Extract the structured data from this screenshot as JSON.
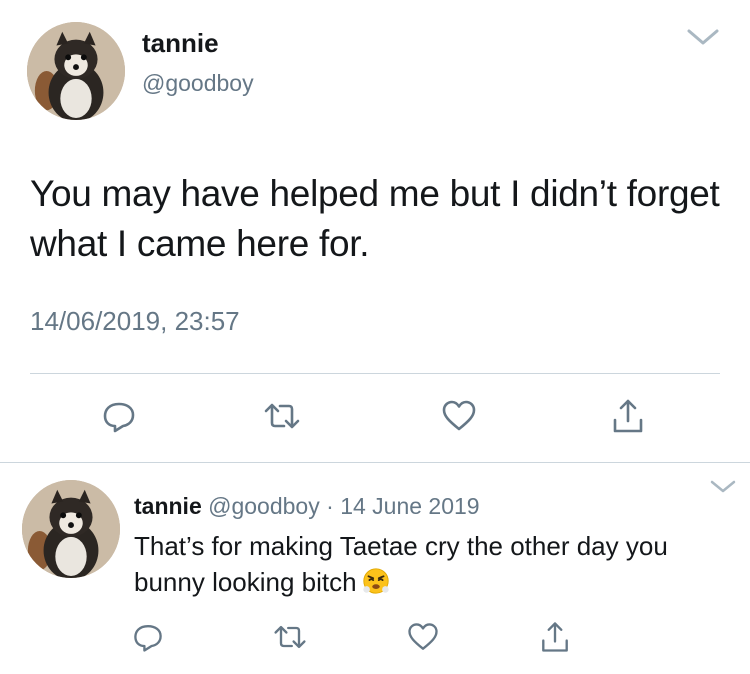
{
  "main_tweet": {
    "display_name": "tannie",
    "handle": "@goodboy",
    "text": "You may have helped me but I didn’t forget what I came here for.",
    "timestamp": "14/06/2019, 23:57"
  },
  "reply_tweet": {
    "display_name": "tannie",
    "handle": "@goodboy",
    "separator": "·",
    "date": "14 June 2019",
    "text": "That’s for making Taetae cry the other day you bunny looking bitch",
    "emoji": "face-with-steam-from-nose"
  },
  "icons": {
    "actions": [
      "reply-icon",
      "retweet-icon",
      "like-icon",
      "share-icon"
    ],
    "menu": "chevron-down-icon"
  },
  "colors": {
    "text": "#14171a",
    "secondary": "#657786",
    "divider": "#ccd6dd",
    "icon": "#657786"
  }
}
